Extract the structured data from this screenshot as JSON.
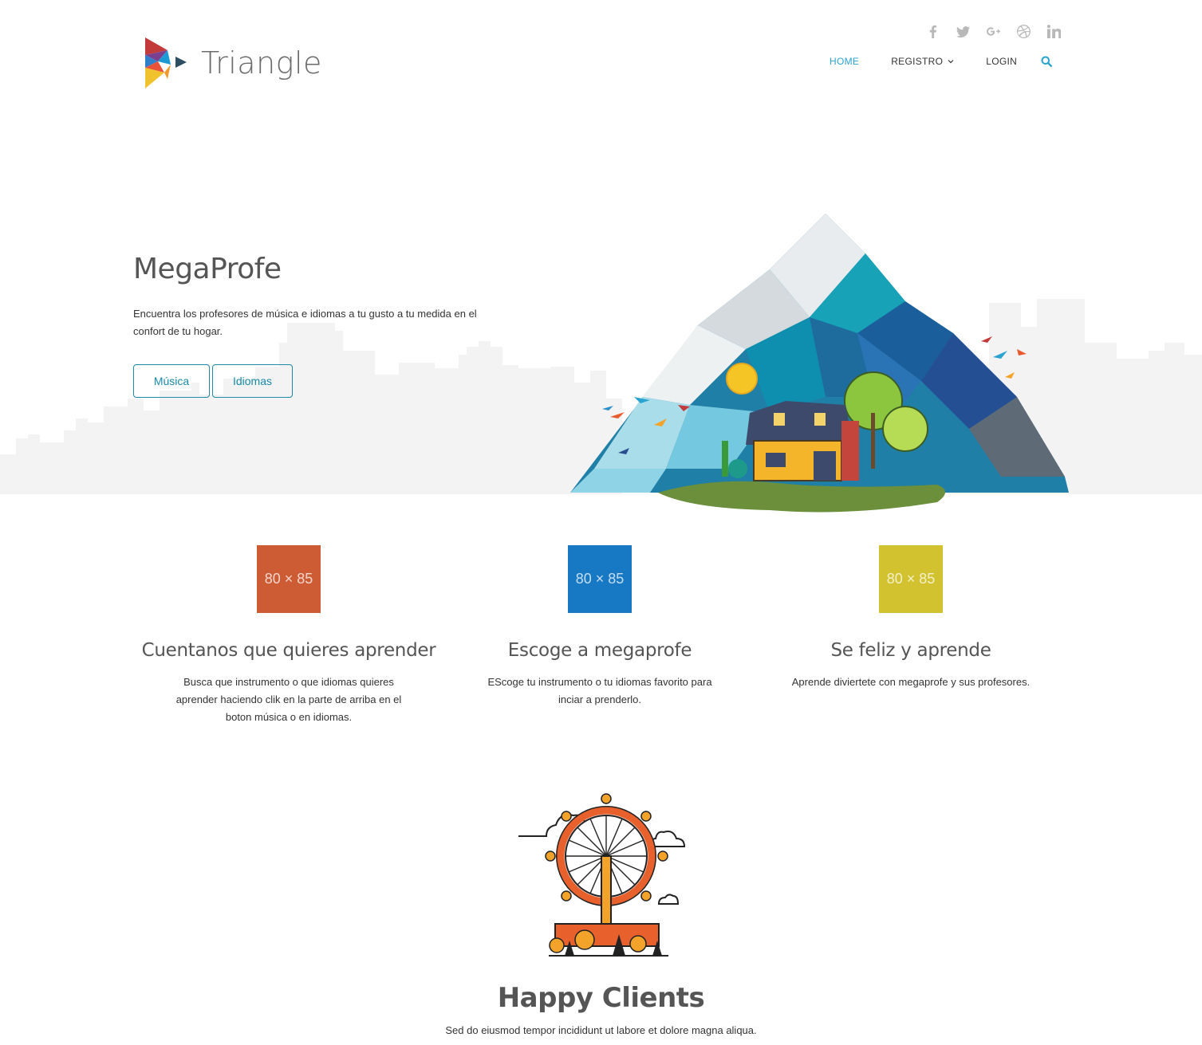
{
  "brand": {
    "name": "Triangle"
  },
  "social": {
    "icons": [
      "facebook-icon",
      "twitter-icon",
      "google-plus-icon",
      "dribbble-icon",
      "linkedin-icon"
    ]
  },
  "nav": {
    "items": [
      {
        "label": "HOME",
        "active": true
      },
      {
        "label": "REGISTRO",
        "dropdown": true
      },
      {
        "label": "LOGIN"
      }
    ],
    "accent": "#2aa3cf"
  },
  "hero": {
    "title": "MegaProfe",
    "text": "Encuentra los profesores de música e idiomas a tu gusto a tu medida en el confort de tu hogar.",
    "buttons": [
      "Música",
      "Idiomas"
    ],
    "button_color": "#1a8aa8"
  },
  "features": [
    {
      "placeholder": "80 × 85",
      "color": "#cd5b34",
      "title": "Cuentanos que quieres aprender",
      "text": "Busca que instrumento o que idiomas quieres aprender haciendo clik en la parte de arriba en el boton música o en idiomas."
    },
    {
      "placeholder": "80 × 85",
      "color": "#1778c3",
      "title": "Escoge a megaprofe",
      "text": "EScoge tu instrumento o tu idiomas favorito para inciar a prenderlo."
    },
    {
      "placeholder": "80 × 85",
      "color": "#d2c22f",
      "title": "Se feliz y aprende",
      "text": "Aprende diviertete con megaprofe y sus profesores."
    }
  ],
  "clients": {
    "title": "Happy Clients",
    "subtitle": "Sed do eiusmod tempor incididunt ut labore et dolore magna aliqua."
  }
}
